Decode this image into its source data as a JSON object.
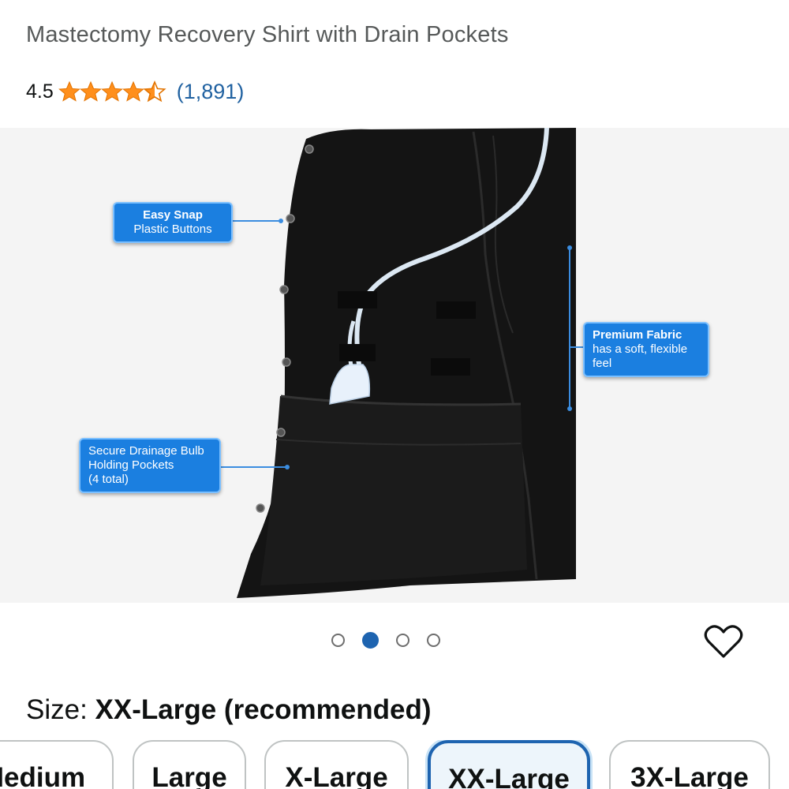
{
  "product": {
    "title": "Mastectomy Recovery Shirt with Drain Pockets",
    "rating_value": "4.5",
    "rating_stars": 4.5,
    "review_count": "(1,891)"
  },
  "colors": {
    "star": "#ff8f1c",
    "link": "#2162a1",
    "accent": "#1e64b0",
    "callout": "#1b7fe0"
  },
  "gallery": {
    "callouts": {
      "snap_title": "Easy Snap",
      "snap_body": "Plastic Buttons",
      "fabric_title": "Premium Fabric",
      "fabric_body_1": "has a soft, flexible",
      "fabric_body_2": "feel",
      "pocket_line_1": "Secure Drainage Bulb",
      "pocket_line_2": "Holding Pockets",
      "pocket_line_3": "(4 total)"
    },
    "image_count": 4,
    "active_index": 1
  },
  "icons": {
    "wishlist": "heart-outline-icon",
    "star": "star-icon"
  },
  "size": {
    "label": "Size: ",
    "selected": "XX-Large (recommended)",
    "options": [
      "Medium",
      "Large",
      "X-Large",
      "XX-Large",
      "3X-Large"
    ],
    "selected_index": 3
  }
}
